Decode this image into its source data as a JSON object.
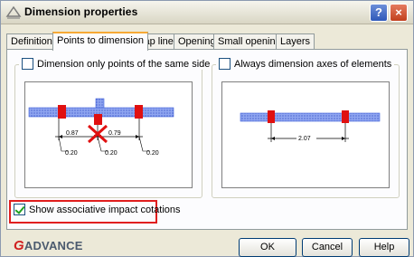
{
  "window": {
    "title": "Dimension properties",
    "help_label": "?",
    "close_label": "×"
  },
  "tabs": [
    {
      "label": "Definition"
    },
    {
      "label": "Points to dimension",
      "active": true
    },
    {
      "label": "Snap lines"
    },
    {
      "label": "Openings"
    },
    {
      "label": "Small openings"
    },
    {
      "label": "Layers"
    }
  ],
  "left_group": {
    "label": "Dimension only points of the same side",
    "checked": false,
    "illustration": {
      "dim_a": "0.87",
      "dim_b": "0.79",
      "offset_left": "0.20",
      "offset_mid": "0.20",
      "offset_right": "0.20"
    }
  },
  "right_group": {
    "label": "Always dimension axes of elements",
    "checked": false,
    "illustration": {
      "dim": "2.07"
    }
  },
  "associative": {
    "label": "Show associative impact cotations",
    "checked": true
  },
  "logo": {
    "mark": "G",
    "text": "ADVANCE"
  },
  "buttons": {
    "ok": "OK",
    "cancel": "Cancel",
    "help": "Help"
  },
  "colors": {
    "wall": "#3d5fd9",
    "marker": "#e01010",
    "highlight": "#e01e1e"
  }
}
